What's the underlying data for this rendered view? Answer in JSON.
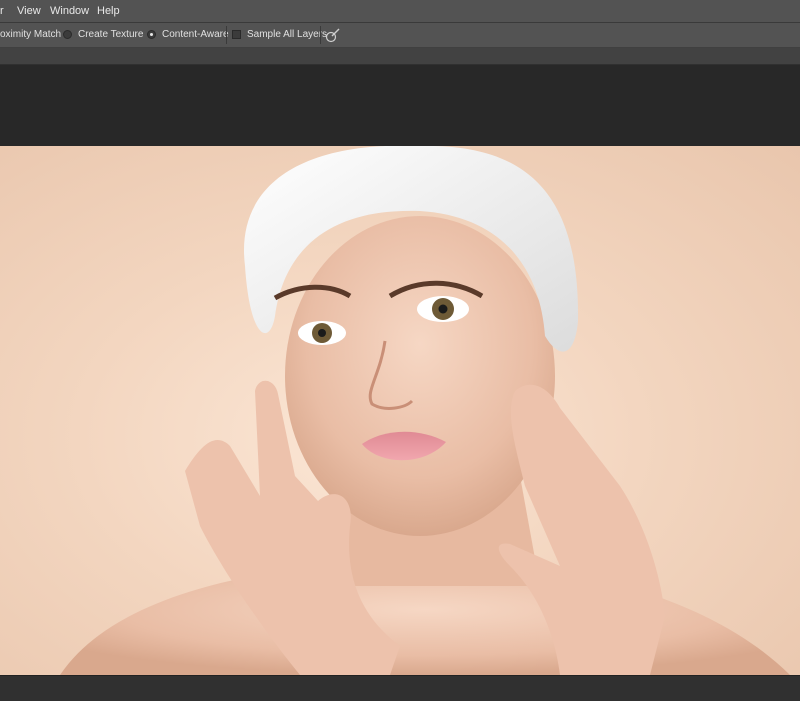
{
  "menubar": {
    "items": [
      "r",
      "View",
      "Window",
      "Help"
    ]
  },
  "options_bar": {
    "proximity_match": "oximity Match",
    "create_texture": "Create Texture",
    "content_aware": "Content-Aware",
    "content_aware_selected": true,
    "sample_all_layers": "Sample All Layers",
    "sample_all_layers_checked": false,
    "pressure_icon": "brush-pressure-icon"
  },
  "document": {
    "image_description_icon": "portrait-photo",
    "colors": {
      "background": "#f3d6c0",
      "towel": "#f4f4f2",
      "skin": "#efcab5"
    }
  }
}
